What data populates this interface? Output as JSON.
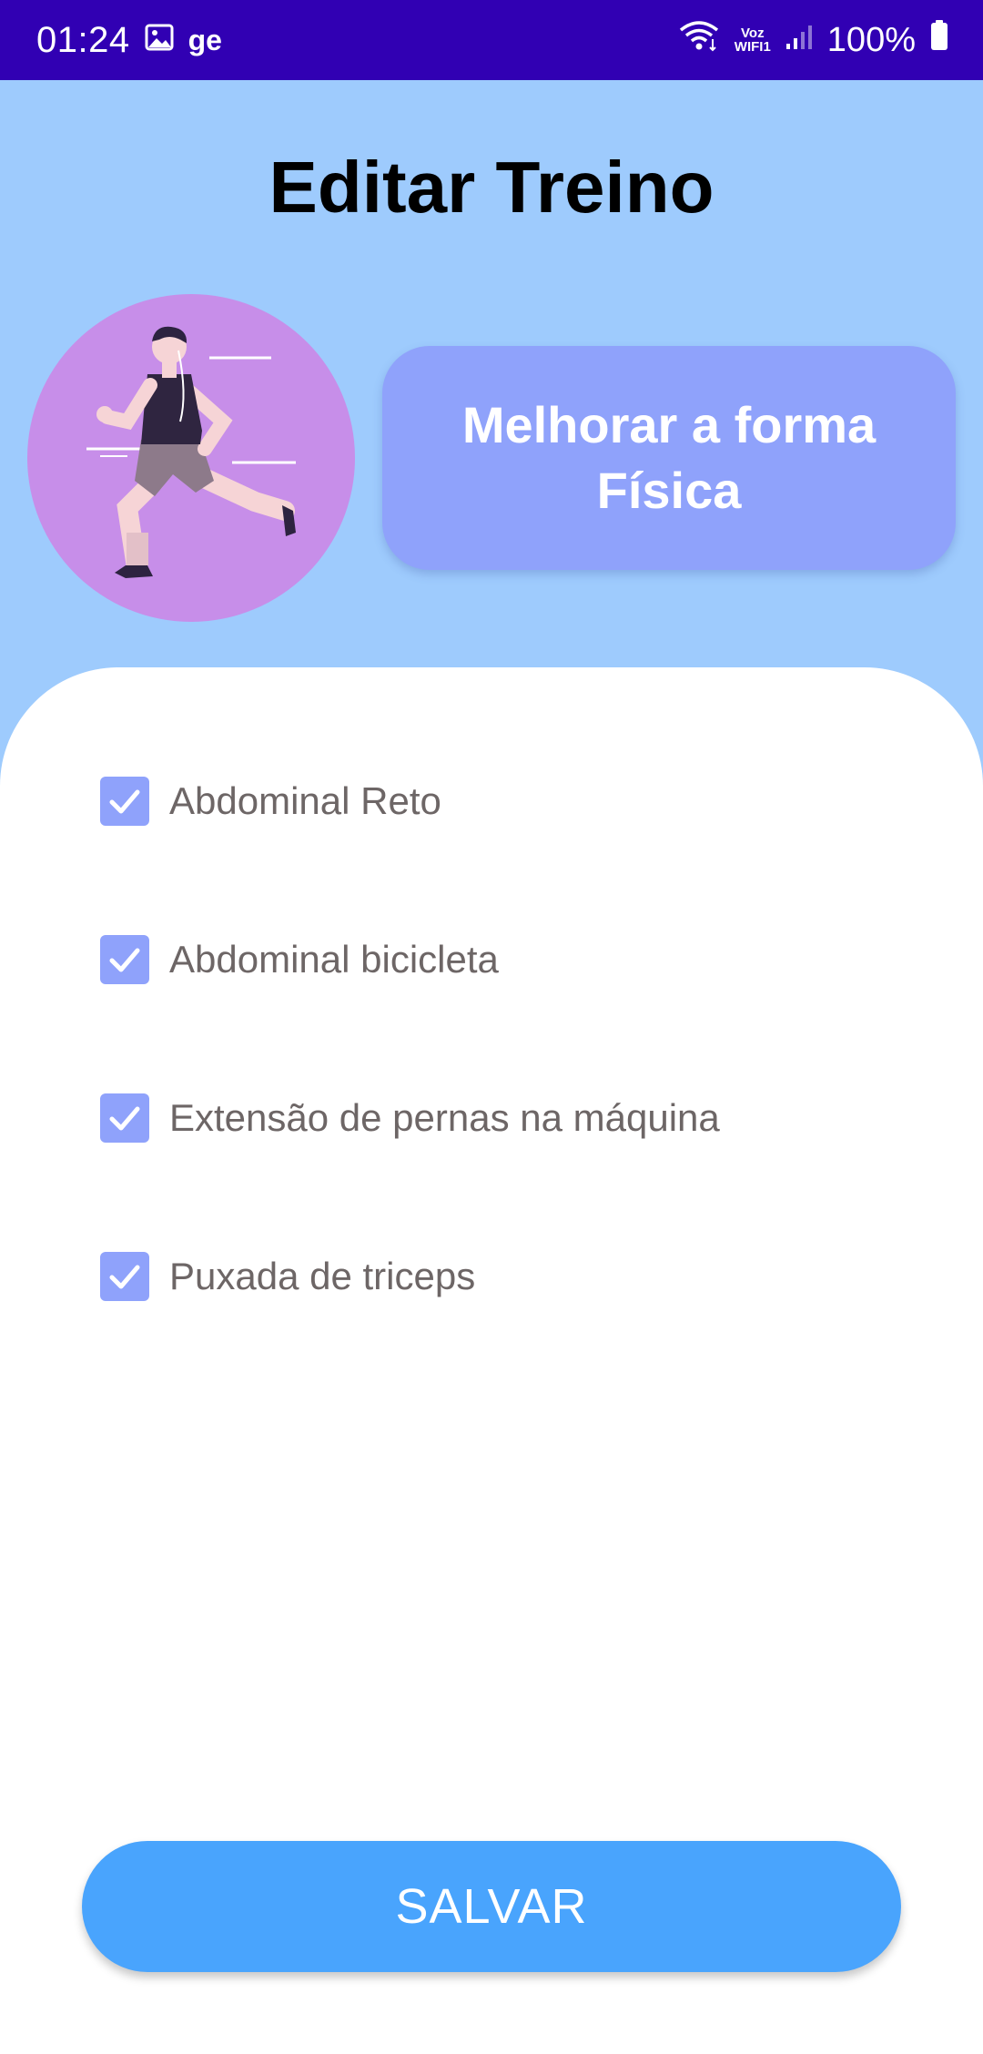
{
  "status_bar": {
    "time": "01:24",
    "notification_text": "ge",
    "voz_top": "Voz",
    "voz_bottom": "WIFI1",
    "battery": "100%"
  },
  "title": "Editar Treino",
  "goal": "Melhorar a forma Física",
  "exercises": [
    {
      "label": "Abdominal Reto",
      "checked": true
    },
    {
      "label": "Abdominal bicicleta",
      "checked": true
    },
    {
      "label": "Extensão de pernas na máquina",
      "checked": true
    },
    {
      "label": "Puxada de triceps",
      "checked": true
    }
  ],
  "save_label": "SALVAR",
  "colors": {
    "status_bar": "#3100b3",
    "background": "#9ecbfd",
    "goal_card": "#8fa2fb",
    "checkbox": "#8fa2fb",
    "save_button": "#49a4fd",
    "avatar": "#c78ee9"
  }
}
